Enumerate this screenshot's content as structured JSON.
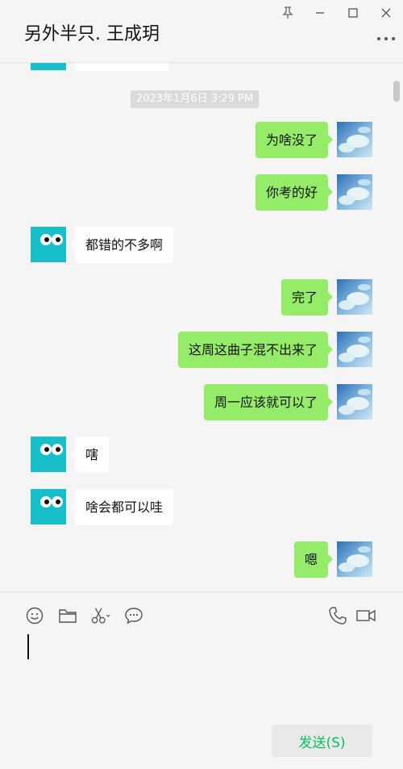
{
  "window": {
    "title": "另外半只. 王成玥",
    "controls": [
      "pin-icon",
      "minimize-icon",
      "maximize-icon",
      "close-icon"
    ]
  },
  "chat": {
    "timestamp": "2023年1月6日 3:29 PM",
    "messages": [
      {
        "sender": "self",
        "text": "为啥没了"
      },
      {
        "sender": "self",
        "text": "你考的好"
      },
      {
        "sender": "other",
        "text": "都错的不多啊"
      },
      {
        "sender": "self",
        "text": "完了"
      },
      {
        "sender": "self",
        "text": "这周这曲子混不出来了"
      },
      {
        "sender": "self",
        "text": "周一应该就可以了"
      },
      {
        "sender": "other",
        "text": "嗐"
      },
      {
        "sender": "other",
        "text": "啥会都可以哇"
      },
      {
        "sender": "self",
        "text": "嗯"
      }
    ]
  },
  "toolbar": {
    "icons": [
      "emoji-icon",
      "folder-icon",
      "scissors-icon",
      "chat-history-icon",
      "phone-icon",
      "video-icon"
    ]
  },
  "composer": {
    "value": "",
    "send_label": "发送(S)"
  },
  "colors": {
    "self_bubble": "#95ec69",
    "other_bubble": "#ffffff",
    "avatar_other": "#18bfca",
    "send_text": "#07c160",
    "background": "#f5f5f5"
  }
}
